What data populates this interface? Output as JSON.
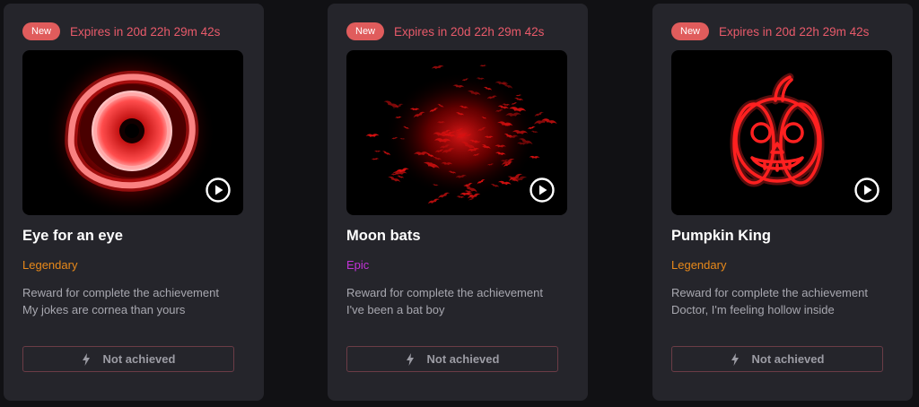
{
  "colors": {
    "legendary": "#e8891a",
    "epic": "#c332d8",
    "expires": "#e85a6a",
    "badge": "#e05c5c"
  },
  "cards": [
    {
      "badge": "New",
      "expires": "Expires in 20d 22h 29m 42s",
      "title": "Eye for an eye",
      "rarity": "Legendary",
      "rarity_color": "#e8891a",
      "desc_line1": "Reward for complete the achievement",
      "desc_line2": "My jokes are cornea than yours",
      "button": "Not achieved",
      "art": "glowing-red-eye"
    },
    {
      "badge": "New",
      "expires": "Expires in 20d 22h 29m 42s",
      "title": "Moon bats",
      "rarity": "Epic",
      "rarity_color": "#c332d8",
      "desc_line1": "Reward for complete the achievement",
      "desc_line2": "I've been a bat boy",
      "button": "Not achieved",
      "art": "red-bat-swarm"
    },
    {
      "badge": "New",
      "expires": "Expires in 20d 22h 29m 42s",
      "title": "Pumpkin King",
      "rarity": "Legendary",
      "rarity_color": "#e8891a",
      "desc_line1": "Reward for complete the achievement",
      "desc_line2": "Doctor, I'm feeling hollow inside",
      "button": "Not achieved",
      "art": "glowing-red-pumpkin"
    }
  ]
}
